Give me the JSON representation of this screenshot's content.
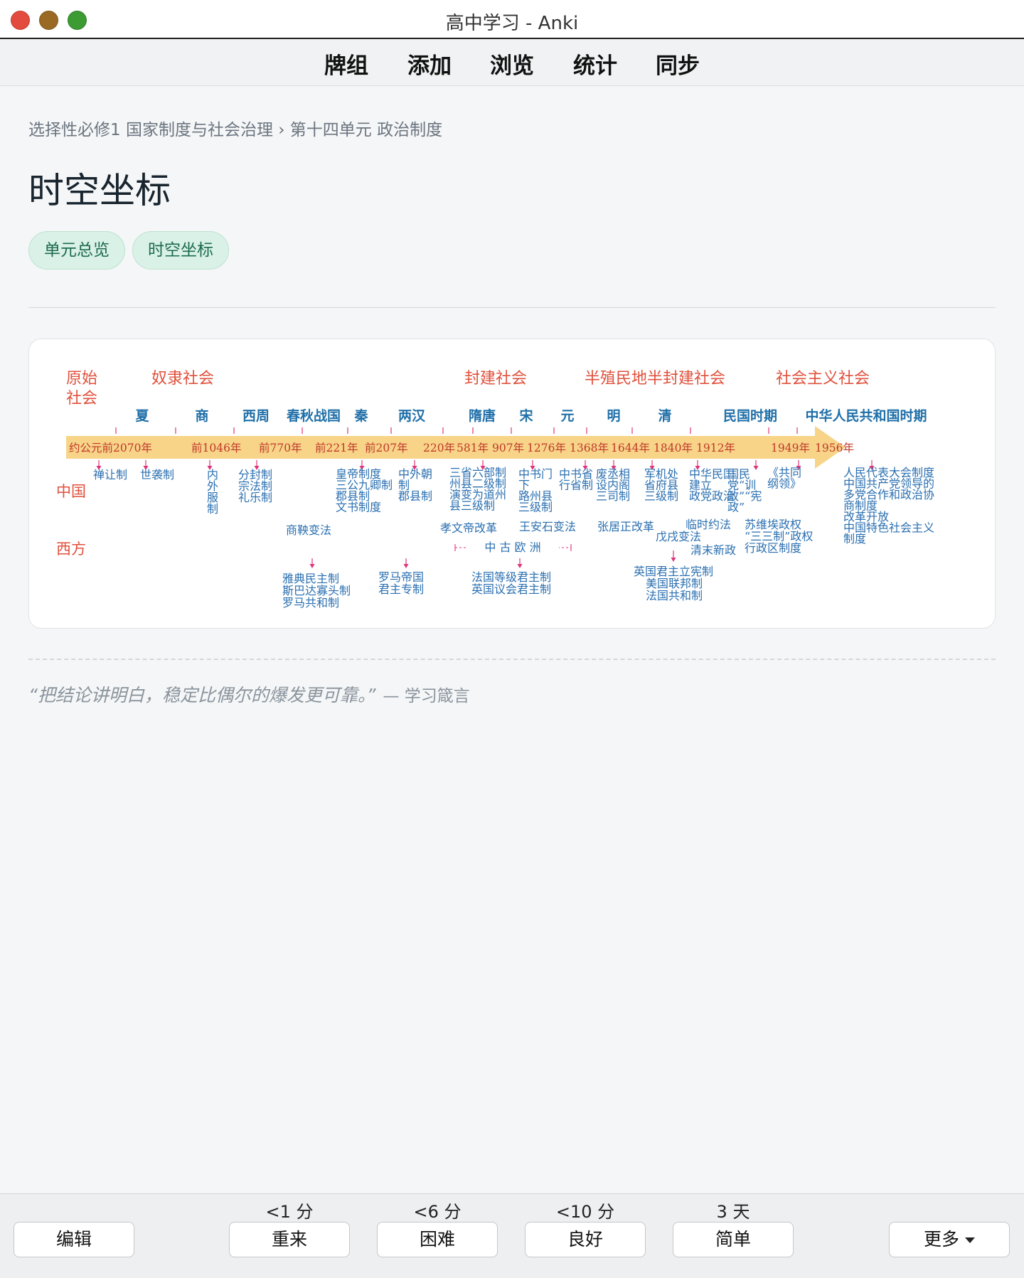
{
  "window": {
    "title": "高中学习 - Anki"
  },
  "toolbar": {
    "items": [
      "牌组",
      "添加",
      "浏览",
      "统计",
      "同步"
    ]
  },
  "breadcrumb": "选择性必修1 国家制度与社会治理 › 第十四单元 政治制度",
  "page_title": "时空坐标",
  "tags": [
    "单元总览",
    "时空坐标"
  ],
  "timeline": {
    "societies": [
      {
        "lines": [
          "原始",
          "社会"
        ]
      },
      {
        "lines": [
          "奴隶社会"
        ]
      },
      {
        "lines": [
          "封建社会"
        ]
      },
      {
        "lines": [
          "半殖民地半封建社会"
        ]
      },
      {
        "lines": [
          "社会主义社会"
        ]
      }
    ],
    "dynasties": [
      "夏",
      "商",
      "西周",
      "春秋战国",
      "秦",
      "两汉",
      "隋唐",
      "宋",
      "元",
      "明",
      "清",
      "民国时期",
      "中华人民共和国时期"
    ],
    "dates": [
      "约公元前2070年",
      "前1046年",
      "前770年",
      "前221年",
      "前207年",
      "220年",
      "581年",
      "907年",
      "1276年",
      "1368年",
      "1644年",
      "1840年",
      "1912年",
      "1949年",
      "1956年"
    ],
    "row_labels": {
      "china": "中国",
      "west": "西方"
    },
    "china_events": [
      {
        "lines": [
          "禅让制"
        ]
      },
      {
        "lines": [
          "世袭制"
        ]
      },
      {
        "lines": [
          "内",
          "外",
          "服",
          "制"
        ]
      },
      {
        "lines": [
          "分封制",
          "宗法制",
          "礼乐制"
        ]
      },
      {
        "lines": [
          "皇帝制度",
          "三公九卿制",
          "郡县制",
          "文书制度"
        ]
      },
      {
        "lines": [
          "中外朝",
          "制",
          "郡县制"
        ]
      },
      {
        "lines": [
          "三省六部制",
          "州县二级制",
          "演变为道州",
          "县三级制"
        ]
      },
      {
        "lines": [
          "中书门",
          "下",
          "路州县",
          "三级制"
        ]
      },
      {
        "lines": [
          "中书省",
          "行省制"
        ]
      },
      {
        "lines": [
          "废丞相",
          "设内阁",
          "三司制"
        ]
      },
      {
        "lines": [
          "军机处",
          "省府县",
          "三级制"
        ]
      },
      {
        "lines": [
          "中华民国",
          "建立",
          "政党政治"
        ]
      },
      {
        "lines": [
          "国民",
          "党“训",
          "政”“宪",
          "政”"
        ]
      },
      {
        "lines": [
          "《共同",
          "纲领》"
        ]
      },
      {
        "lines": [
          "人民代表大会制度",
          "中国共产党领导的",
          "多党合作和政治协",
          "商制度",
          "改革开放",
          "中国特色社会主义",
          "制度"
        ]
      },
      {
        "lines": [
          "商鞅变法"
        ]
      },
      {
        "lines": [
          "孝文帝改革"
        ]
      },
      {
        "lines": [
          "王安石变法"
        ]
      },
      {
        "lines": [
          "张居正改革"
        ]
      },
      {
        "lines": [
          "临时约法"
        ]
      },
      {
        "lines": [
          "戊戌变法"
        ]
      },
      {
        "lines": [
          "清末新政"
        ]
      },
      {
        "lines": [
          "苏维埃政权",
          "“三三制”政权",
          "行政区制度"
        ]
      }
    ],
    "middle_ages_label": "中 古 欧 洲",
    "west_events": [
      {
        "lines": [
          "雅典民主制",
          "斯巴达寡头制",
          "罗马共和制"
        ]
      },
      {
        "lines": [
          "罗马帝国",
          "君主专制"
        ]
      },
      {
        "lines": [
          "法国等级君主制",
          "英国议会君主制"
        ]
      },
      {
        "lines": [
          "英国君主立宪制",
          "美国联邦制",
          "法国共和制"
        ]
      }
    ]
  },
  "quote": {
    "text": "“把结论讲明白，稳定比偶尔的爆发更可靠。”",
    "source": "— 学习箴言"
  },
  "answer_bar": {
    "intervals": [
      "<1 分",
      "<6 分",
      "<10 分",
      "3 天"
    ],
    "edit_label": "编辑",
    "buttons": [
      "重来",
      "困难",
      "良好",
      "简单"
    ],
    "more_label": "更多"
  },
  "colors": {
    "society_red": "#e0503c",
    "dynasty_blue": "#1f6fa8",
    "event_blue": "#2a6fb0",
    "arrow_band": "#f7d488",
    "marker_pink": "#e0337a",
    "chip_bg": "#d9f1e6",
    "chip_text": "#1d6b4e"
  }
}
